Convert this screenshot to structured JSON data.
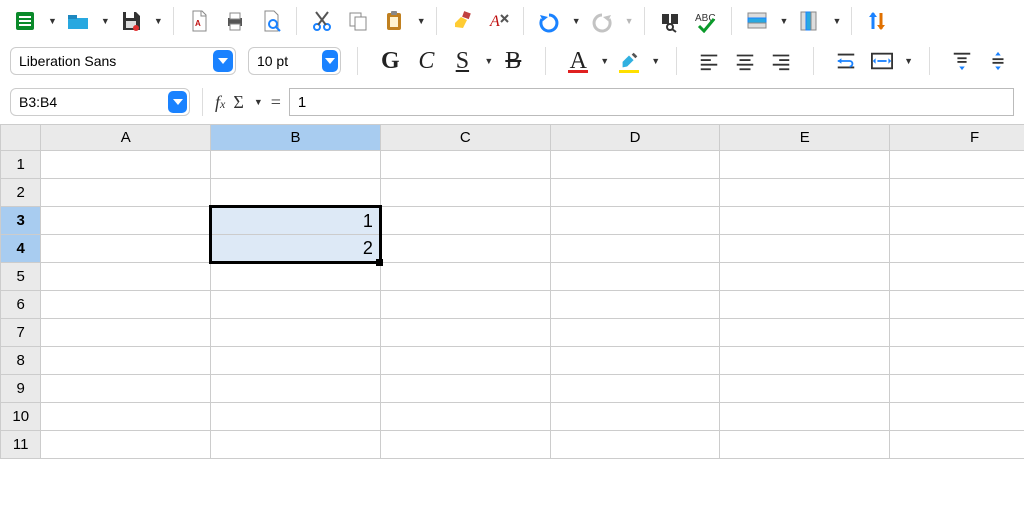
{
  "toolbar": {
    "font_name": "Liberation Sans",
    "font_size": "10 pt"
  },
  "name_box": "B3:B4",
  "formula": "1",
  "columns": [
    "A",
    "B",
    "C",
    "D",
    "E",
    "F"
  ],
  "rows": [
    "1",
    "2",
    "3",
    "4",
    "5",
    "6",
    "7",
    "8",
    "9",
    "10",
    "11"
  ],
  "selected_column_index": 1,
  "selected_rows": [
    2,
    3
  ],
  "cells": {
    "B3": "1",
    "B4": "2"
  }
}
